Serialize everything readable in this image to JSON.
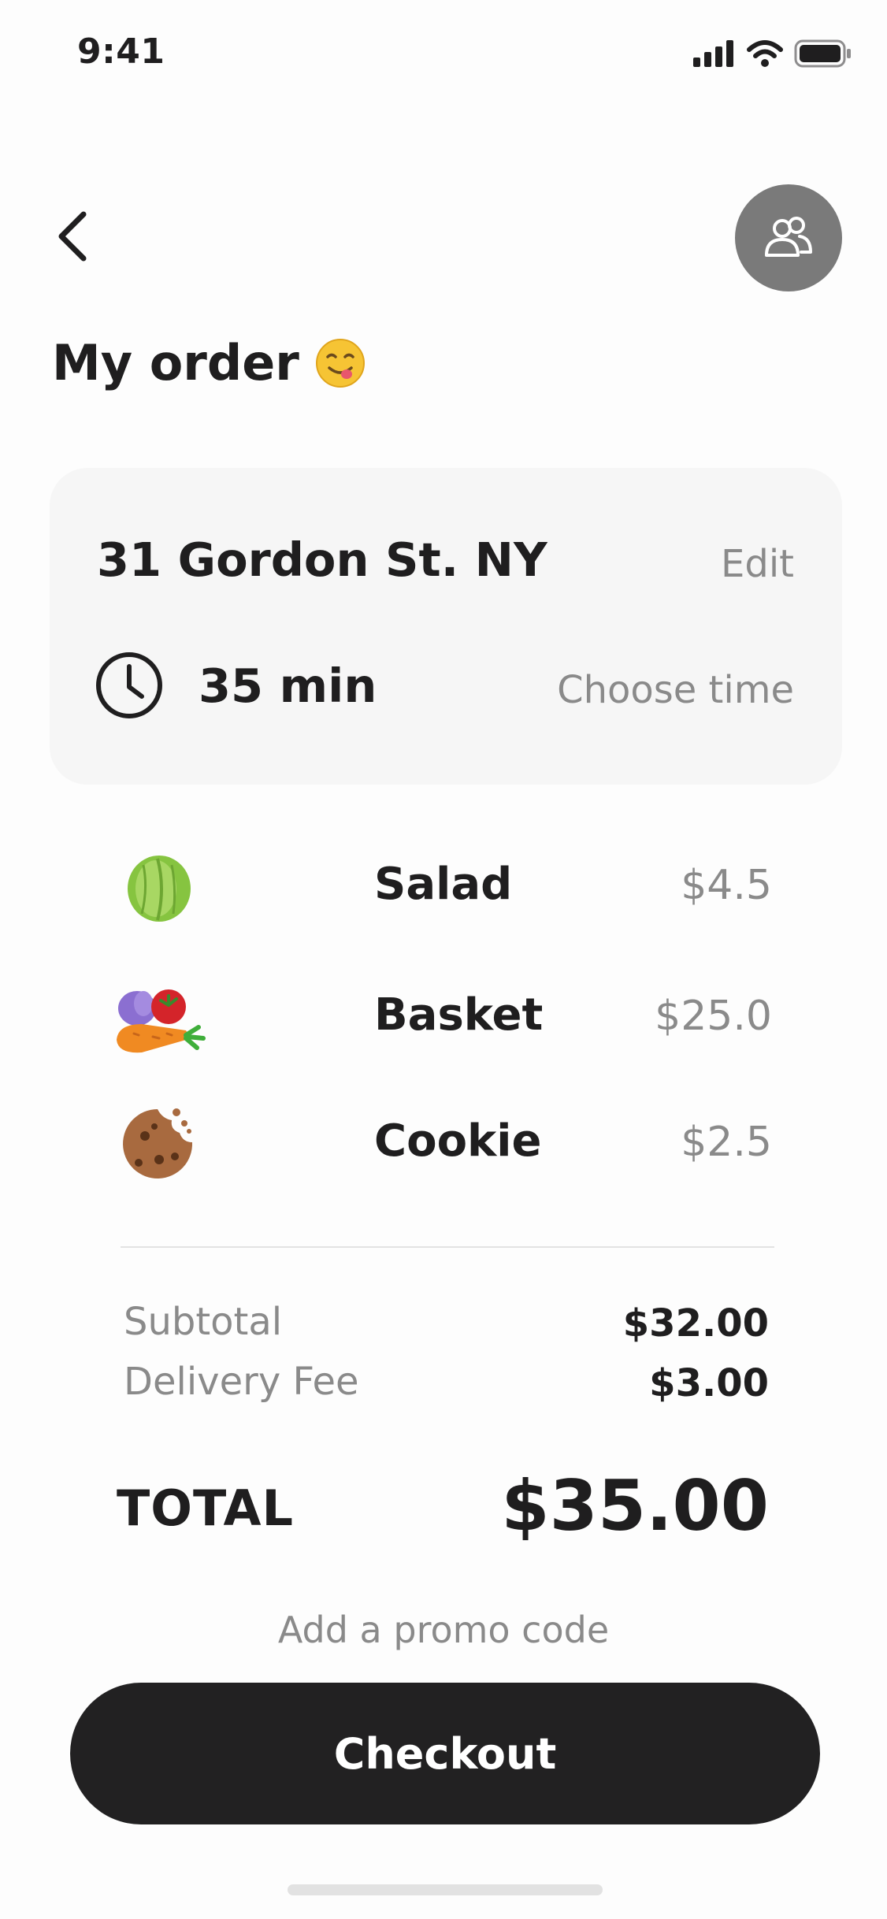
{
  "status_bar": {
    "time": "9:41"
  },
  "header": {
    "title": "My order"
  },
  "address_card": {
    "address": "31 Gordon St. NY",
    "edit_label": "Edit",
    "eta": "35 min",
    "choose_time_label": "Choose time"
  },
  "items": [
    {
      "name": "Salad",
      "price": "$4.5",
      "icon": "lettuce-icon"
    },
    {
      "name": "Basket",
      "price": "$25.0",
      "icon": "vegetable-basket-icon"
    },
    {
      "name": "Cookie",
      "price": "$2.5",
      "icon": "cookie-icon"
    }
  ],
  "summary": {
    "subtotal_label": "Subtotal",
    "subtotal_value": "$32.00",
    "delivery_label": "Delivery Fee",
    "delivery_value": "$3.00",
    "total_label": "TOTAL",
    "total_value": "$35.00"
  },
  "promo_label": "Add a promo code",
  "checkout_label": "Checkout",
  "colors": {
    "accent": "#222122",
    "muted_text": "#8a8a8a",
    "card_bg": "#f6f6f6",
    "group_button_bg": "#7a7a7a"
  }
}
